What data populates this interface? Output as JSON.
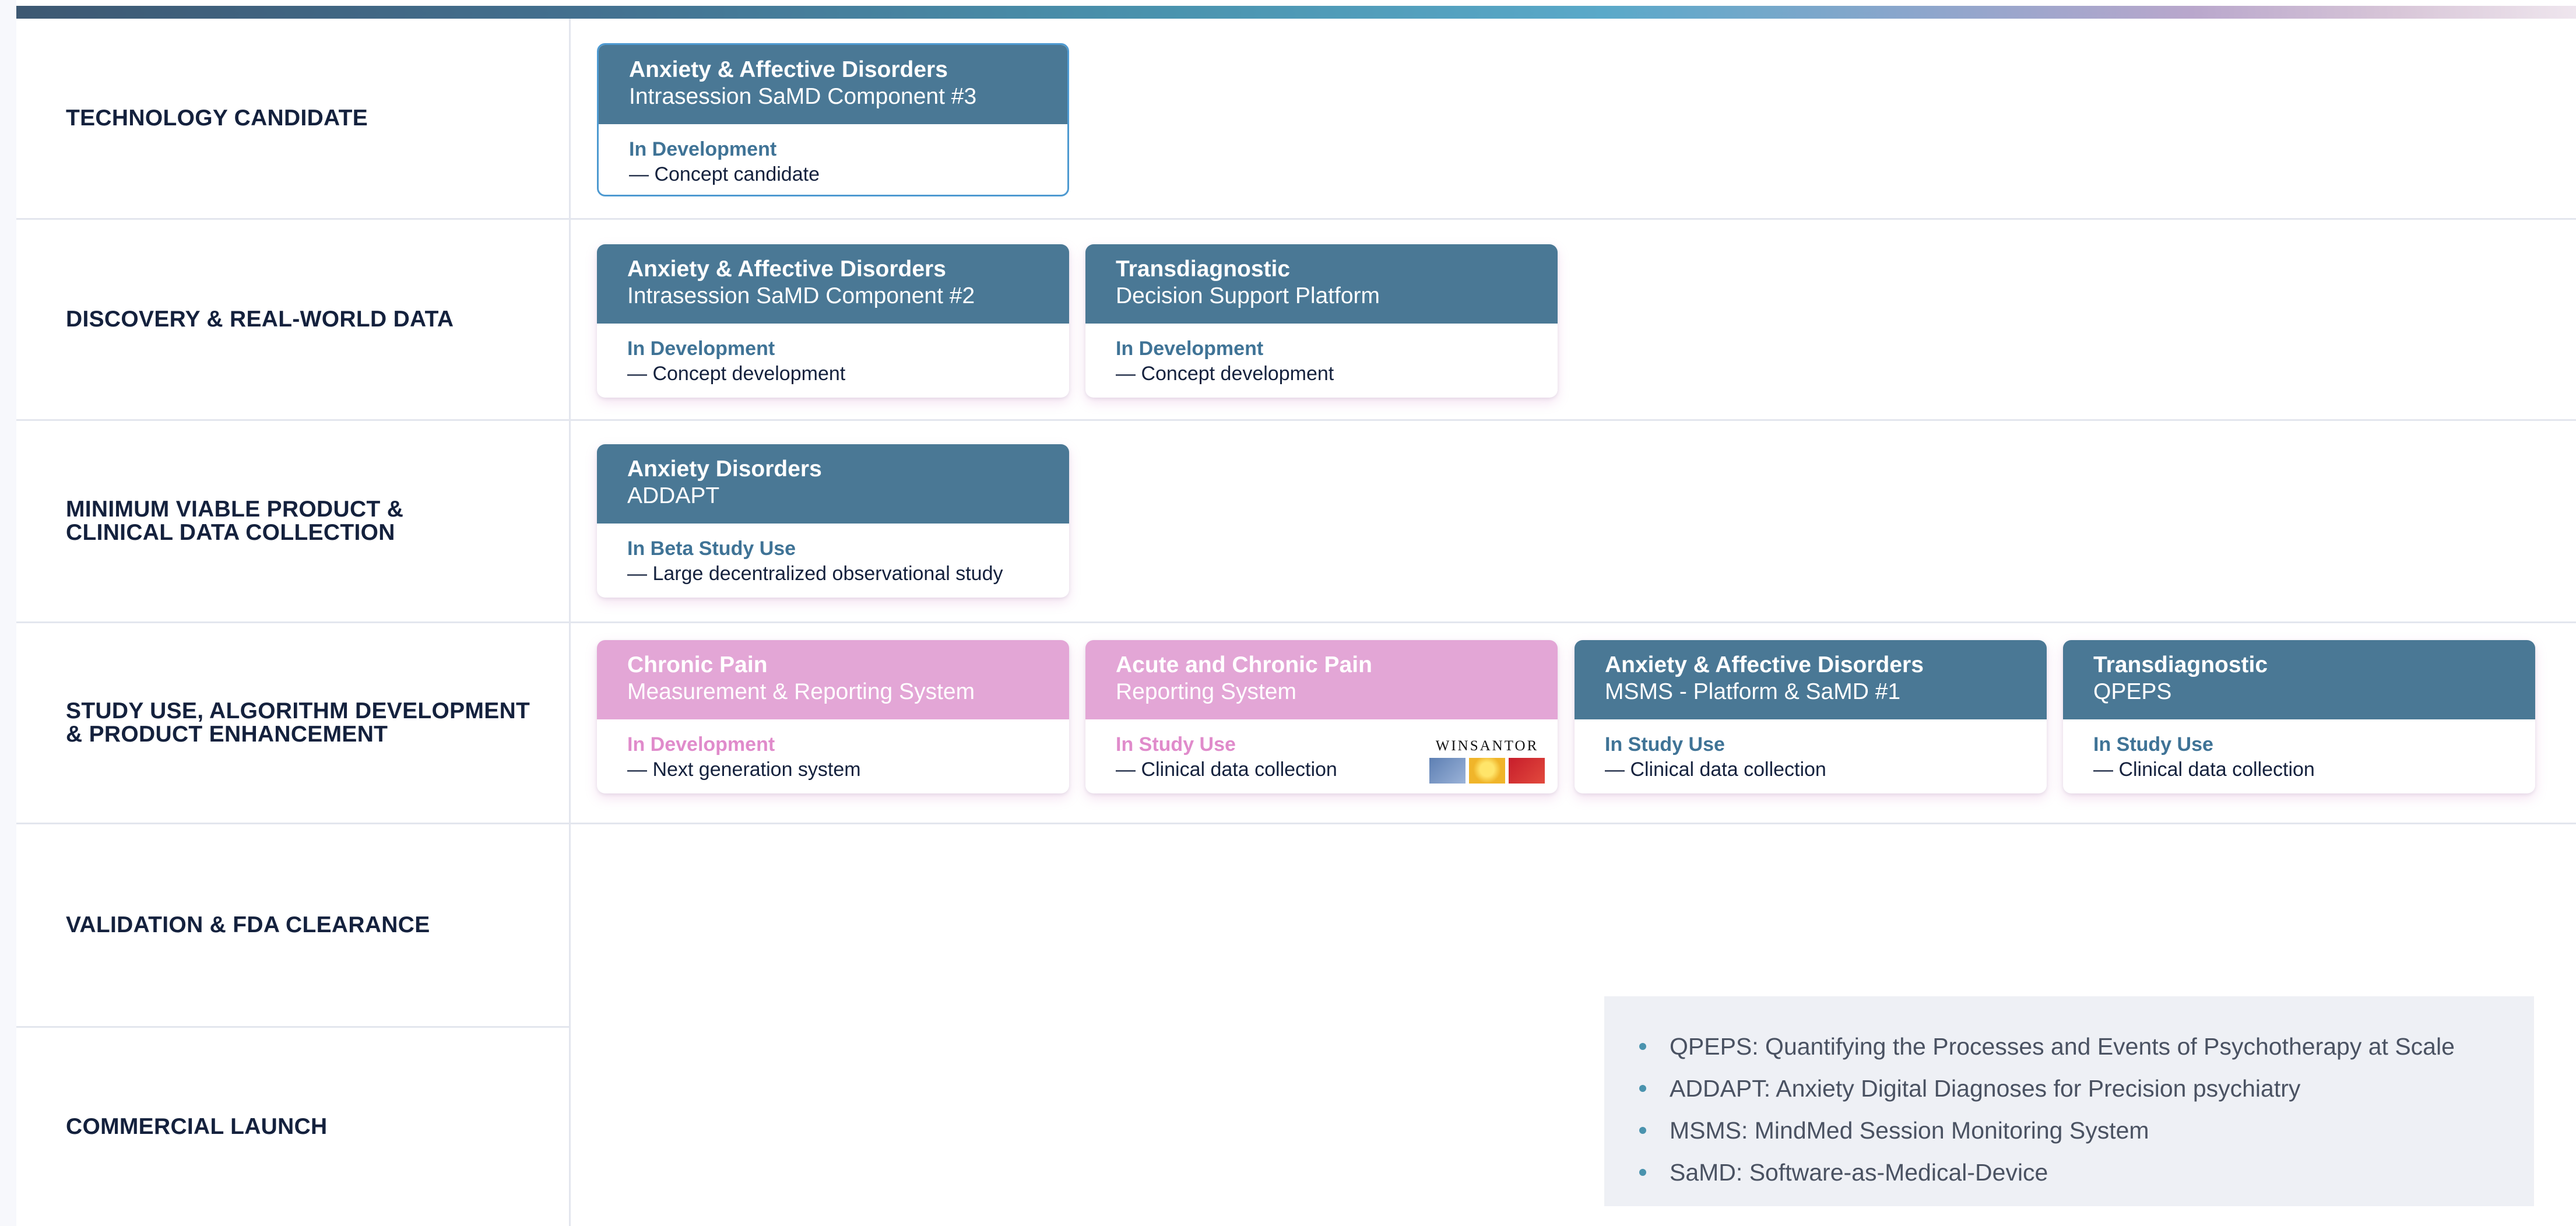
{
  "rows": [
    {
      "label": "TECHNOLOGY CANDIDATE"
    },
    {
      "label": "DISCOVERY & REAL-WORLD DATA"
    },
    {
      "label": "MINIMUM VIABLE PRODUCT &\nCLINICAL DATA COLLECTION"
    },
    {
      "label": "STUDY USE, ALGORITHM DEVELOPMENT\n& PRODUCT ENHANCEMENT"
    },
    {
      "label": "VALIDATION & FDA CLEARANCE"
    },
    {
      "label": "COMMERCIAL LAUNCH"
    }
  ],
  "cards": {
    "tech_candidate_samd3": {
      "title": "Anxiety & Affective Disorders",
      "subtitle": "Intrasession SaMD Component #3",
      "status": "In Development",
      "note": "— Concept candidate"
    },
    "discovery_samd2": {
      "title": "Anxiety & Affective Disorders",
      "subtitle": "Intrasession SaMD Component #2",
      "status": "In Development",
      "note": "— Concept development"
    },
    "discovery_decision": {
      "title": "Transdiagnostic",
      "subtitle": "Decision Support Platform",
      "status": "In Development",
      "note": "— Concept development"
    },
    "mvp_addapt": {
      "title": "Anxiety Disorders",
      "subtitle": "ADDAPT",
      "status": "In Beta Study Use",
      "note": "— Large decentralized observational study"
    },
    "study_chronic_pain": {
      "title": "Chronic Pain",
      "subtitle": "Measurement & Reporting System",
      "status": "In Development",
      "note": "— Next generation system"
    },
    "study_acute_pain": {
      "title": "Acute and Chronic Pain",
      "subtitle": "Reporting System",
      "status": "In Study Use",
      "note": "— Clinical data collection",
      "partner_logo": "WINSANTOR"
    },
    "study_msms": {
      "title": "Anxiety & Affective Disorders",
      "subtitle": "MSMS - Platform & SaMD #1",
      "status": "In Study Use",
      "note": "— Clinical data collection"
    },
    "study_qpeps": {
      "title": "Transdiagnostic",
      "subtitle": "QPEPS",
      "status": "In Study Use",
      "note": "— Clinical data collection"
    }
  },
  "legend": [
    "QPEPS: Quantifying the Processes and Events of Psychotherapy at Scale",
    "ADDAPT: Anxiety Digital Diagnoses for Precision psychiatry",
    "MSMS: MindMed Session Monitoring System",
    "SaMD: Software-as-Medical-Device"
  ],
  "colors": {
    "card_blue": "#4a7895",
    "card_pink": "#e3a6d6",
    "label_navy": "#14213d"
  }
}
